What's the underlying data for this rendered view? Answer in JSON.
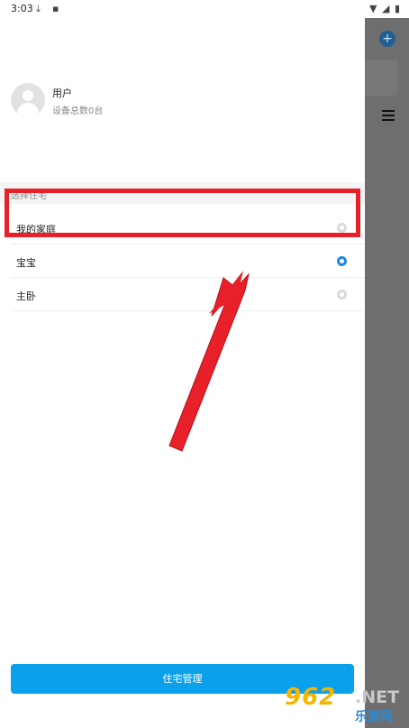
{
  "status_bar": {
    "time": "3:03",
    "left_icons": [
      "download-icon",
      "app-icon"
    ],
    "right_icons": [
      "wifi-icon",
      "signal-icon",
      "battery-icon"
    ]
  },
  "drawer": {
    "user": {
      "name": "用户",
      "device_count": "设备总数0台"
    },
    "section_label": "选择住宅",
    "homes": [
      {
        "label": "我的家庭",
        "selected": false
      },
      {
        "label": "宝宝",
        "selected": true
      },
      {
        "label": "主卧",
        "selected": false
      }
    ],
    "manage_button": "住宅管理"
  },
  "annotation": {
    "color": "#e8202a"
  },
  "watermark": {
    "number": "962",
    "domain": ".NET",
    "name": "乐游网"
  },
  "colors": {
    "accent": "#0aa0ec",
    "radio_selected": "#1e88e5",
    "overlay": "#6e6e6e"
  }
}
